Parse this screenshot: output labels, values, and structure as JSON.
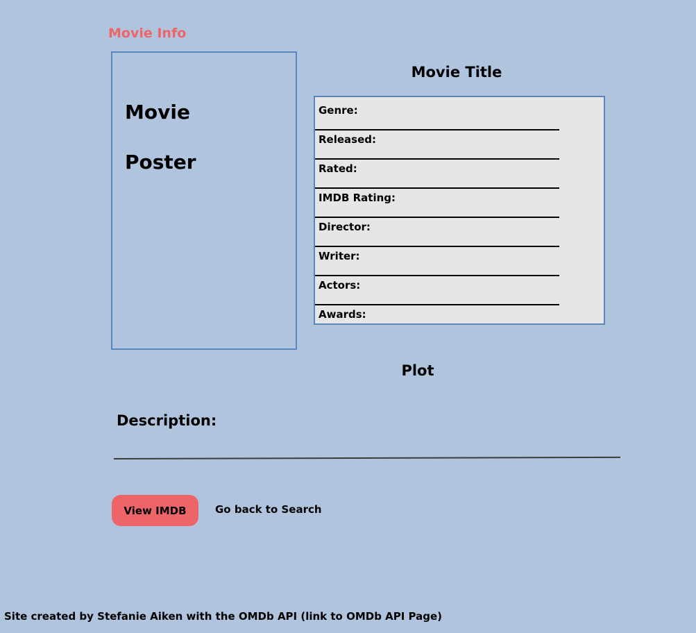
{
  "header": {
    "title": "Movie Info"
  },
  "poster": {
    "line1": "Movie",
    "line2": "Poster"
  },
  "details": {
    "title": "Movie Title",
    "fields": [
      "Genre:",
      "Released:",
      "Rated:",
      "IMDB Rating:",
      "Director:",
      "Writer:",
      "Actors:",
      "Awards:"
    ]
  },
  "plot": {
    "heading": "Plot",
    "description_label": "Description:"
  },
  "actions": {
    "imdb_button": "View IMDB",
    "back_link": "Go back to Search"
  },
  "footer": {
    "text": "Site created by Stefanie Aiken with the OMDb API (link to OMDb API Page)"
  },
  "colors": {
    "background": "#b0c4de",
    "accent": "#ee6569",
    "border": "#5b86bd",
    "panel": "#e6e6e6"
  }
}
